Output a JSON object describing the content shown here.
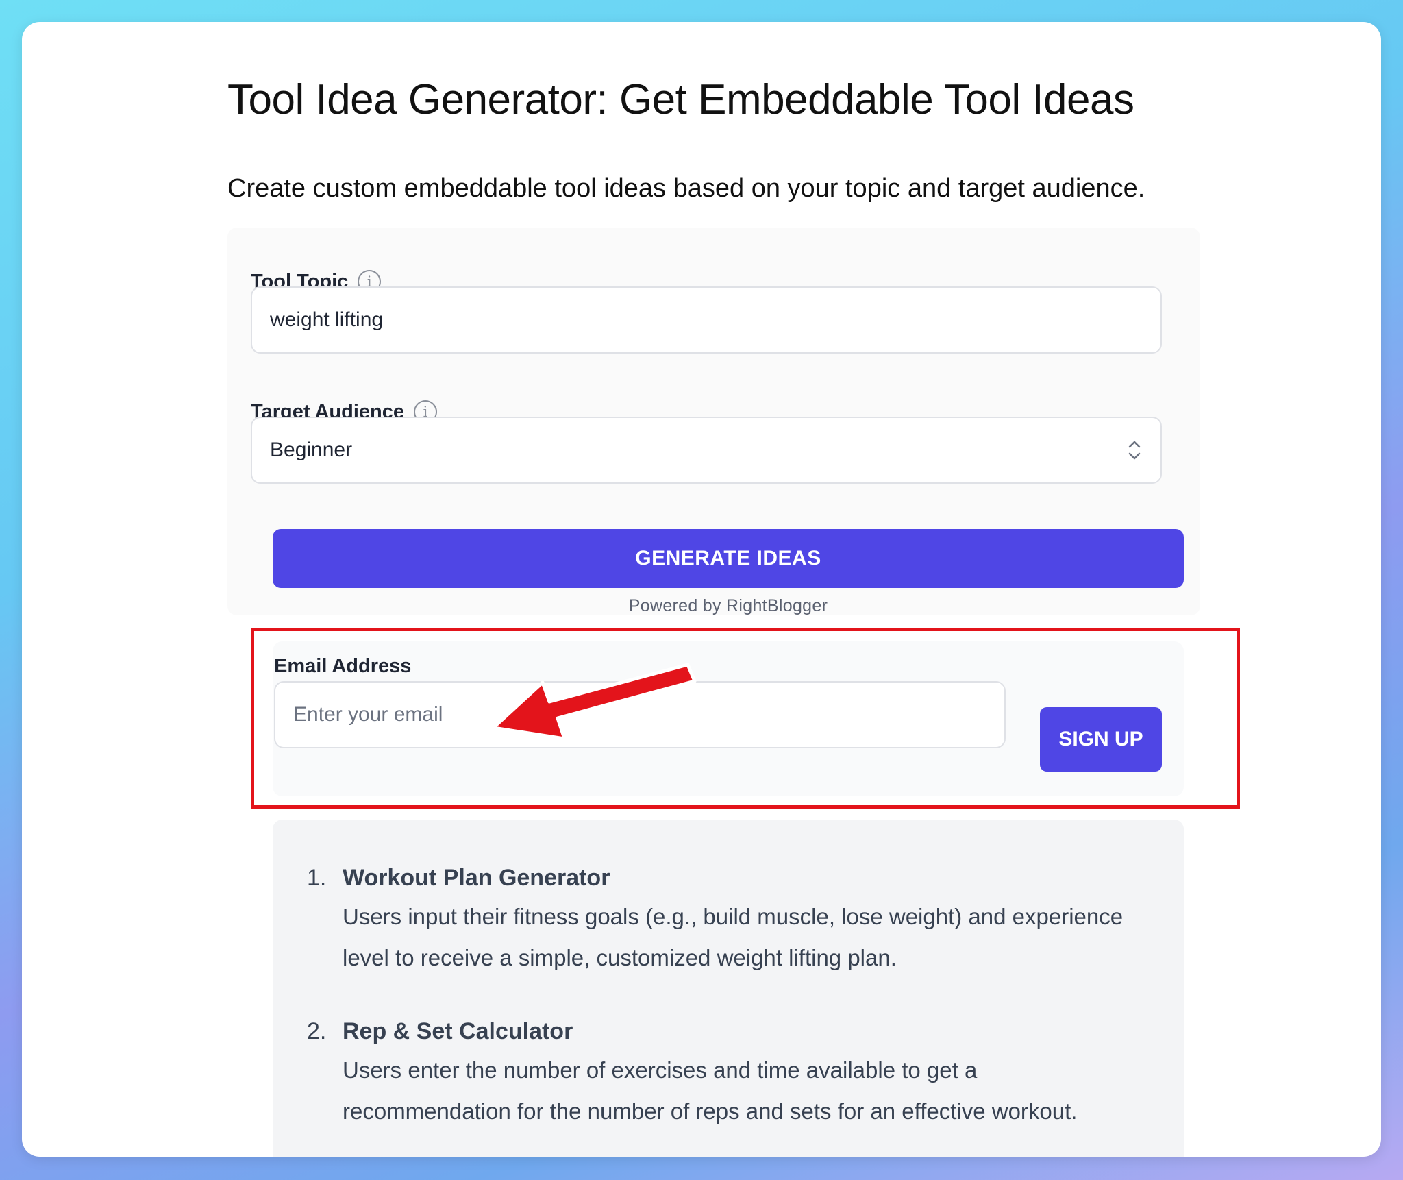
{
  "page": {
    "title": "Tool Idea Generator: Get Embeddable Tool Ideas",
    "subtitle": "Create custom embeddable tool ideas based on your topic and target audience."
  },
  "form": {
    "topic_label": "Tool Topic",
    "topic_value": "weight lifting",
    "audience_label": "Target Audience",
    "audience_value": "Beginner",
    "generate_label": "GENERATE IDEAS",
    "powered_by": "Powered by RightBlogger"
  },
  "signup": {
    "email_label": "Email Address",
    "email_placeholder": "Enter your email",
    "button_label": "SIGN UP"
  },
  "annotation": {
    "highlight_color": "#e3141b",
    "arrow_color": "#e3141b"
  },
  "ideas": [
    {
      "number": "1.",
      "title": "Workout Plan Generator",
      "description": "Users input their fitness goals (e.g., build muscle, lose weight) and experience level to receive a simple, customized weight lifting plan."
    },
    {
      "number": "2.",
      "title": "Rep & Set Calculator",
      "description": "Users enter the number of exercises and time available to get a recommendation for the number of reps and sets for an effective workout."
    }
  ],
  "colors": {
    "accent": "#4f46e5",
    "card": "#ffffff",
    "results_bg": "#f3f4f6"
  }
}
